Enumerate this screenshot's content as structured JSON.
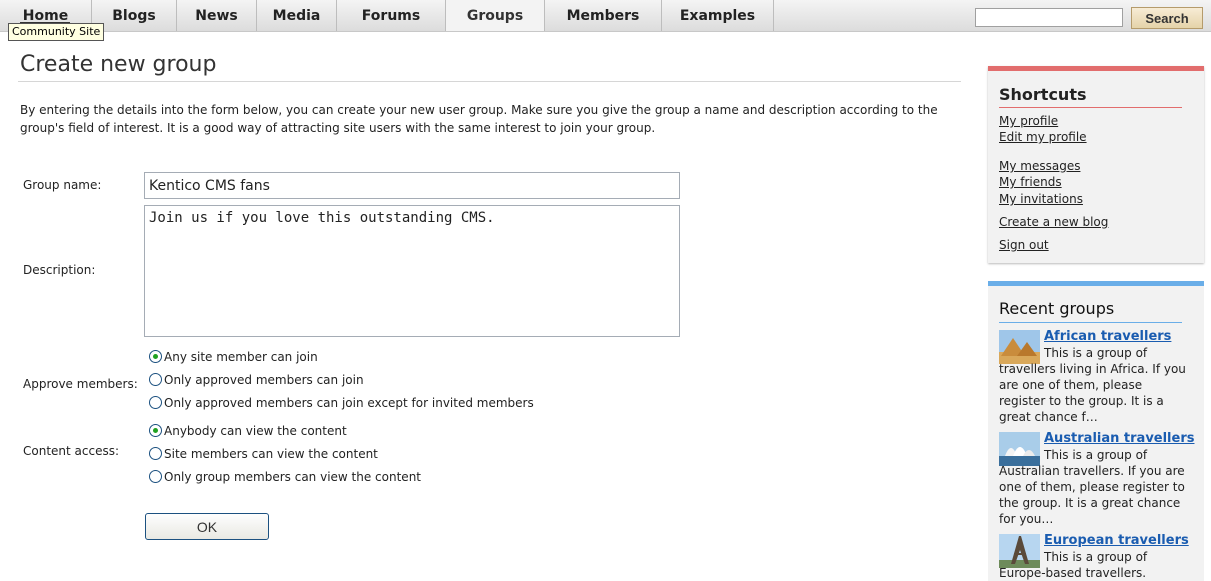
{
  "nav": {
    "items": [
      "Home",
      "Blogs",
      "News",
      "Media",
      "Forums",
      "Groups",
      "Members",
      "Examples"
    ],
    "active": "Groups"
  },
  "tooltip": "Community Site",
  "search": {
    "placeholder": "",
    "button_label": "Search"
  },
  "main": {
    "title": "Create new group",
    "intro": "By entering the details into the form below, you can create your new user group. Make sure you give the group a  name and description according to the group's field of interest. It is a good way of attracting site users with the same interest to join your group.",
    "form": {
      "group_name_label": "Group name:",
      "group_name_value": "Kentico CMS fans",
      "description_label": "Description:",
      "description_value": "Join us if you love this outstanding CMS.",
      "approve_label": "Approve members:",
      "approve_options": [
        "Any site member can join",
        "Only approved members can join",
        "Only approved members can join except for invited members"
      ],
      "approve_selected": 0,
      "content_label": "Content access:",
      "content_options": [
        "Anybody can view the content",
        "Site members can view the content",
        "Only group members can view the content"
      ],
      "content_selected": 0,
      "ok_label": "OK"
    }
  },
  "sidebar": {
    "shortcuts": {
      "title": "Shortcuts",
      "links": [
        "My profile",
        "Edit my profile",
        "My messages",
        "My friends",
        "My invitations",
        "Create a new blog",
        "Sign out"
      ]
    },
    "recent_groups": {
      "title": "Recent groups",
      "items": [
        {
          "name": "African travellers",
          "text": "This is a group of travellers living in Africa. If you are one of them, please register to the group. It is a great chance f…"
        },
        {
          "name": "Australian travellers",
          "text": "This is a group of Australian travellers. If you are one of them, please register to the group. It is a great chance for you…"
        },
        {
          "name": "European travellers",
          "text": "This is a group of Europe-based travellers."
        }
      ]
    }
  },
  "colors": {
    "shortcuts_accent": "#e26d6d",
    "recent_accent": "#6aaee8",
    "link_blue": "#1a5cb0"
  }
}
